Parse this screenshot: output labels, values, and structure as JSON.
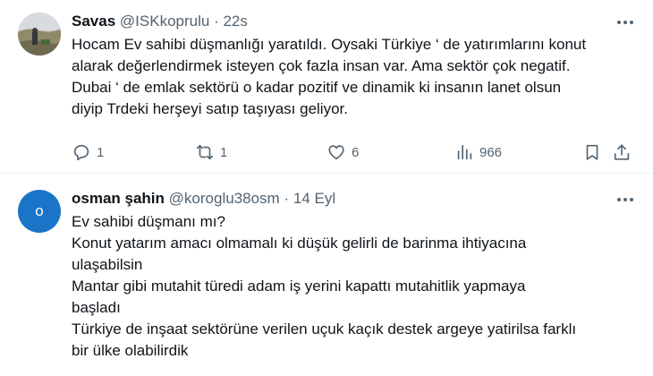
{
  "tweets": [
    {
      "name": "Savas",
      "handle": "@ISKkoprulu",
      "separator": "·",
      "time": "22s",
      "lines": [
        "Hocam Ev sahibi düşmanlığı yaratıldı. Oysaki Türkiye ‘ de yatırımlarını konut",
        "alarak değerlendirmek isteyen çok fazla insan var. Ama sektör çok negatif.",
        "Dubai ‘ de emlak sektörü o kadar pozitif ve dinamik ki insanın lanet olsun",
        "diyip Trdeki herşeyi satıp taşıyası geliyor."
      ],
      "actions": {
        "replies": "1",
        "reposts": "1",
        "likes": "6",
        "views": "966"
      },
      "icons": [
        "reply-icon",
        "repost-icon",
        "like-icon",
        "views-icon",
        "bookmark-icon",
        "share-icon"
      ]
    },
    {
      "name": "osman şahin",
      "handle": "@koroglu38osm",
      "separator": "·",
      "time": "14 Eyl",
      "avatar_letter": "o",
      "lines": [
        "Ev sahibi düşmanı mı?",
        "Konut yatarım amacı olmamalı ki düşük gelirli de barinma ihtiyacına",
        "ulaşabilsin",
        "Mantar gibi mutahit türedi adam iş yerini kapattı mutahitlik yapmaya",
        "başladı",
        "Türkiye de inşaat sektörüne verilen uçuk kaçık destek argeye yatirilsa farklı",
        "bir ülke olabilirdik"
      ]
    }
  ],
  "colors": {
    "text": "#0f1419",
    "secondary": "#536471",
    "avatar_bg": "#1a74c8",
    "divider": "#eff3f4"
  }
}
